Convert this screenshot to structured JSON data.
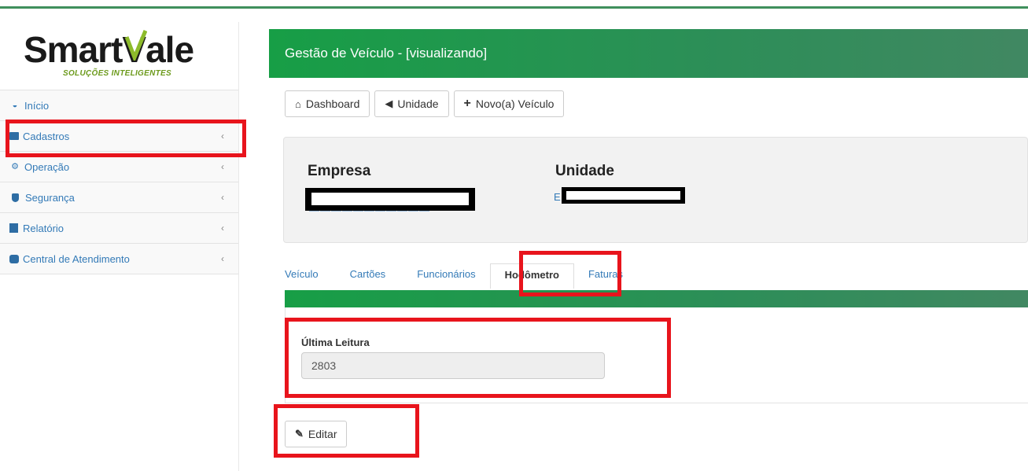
{
  "brand": {
    "name_prefix": "Smart",
    "name_v": "V",
    "name_suffix": "ale",
    "tagline": "SOLUÇÕES INTELIGENTES",
    "accent": "#6c9a1c"
  },
  "sidebar": {
    "items": [
      {
        "label": "Início",
        "icon": "dashboard-icon",
        "has_chevron": false
      },
      {
        "label": "Cadastros",
        "icon": "list-box-icon",
        "has_chevron": true
      },
      {
        "label": "Operação",
        "icon": "cogs-icon",
        "has_chevron": true
      },
      {
        "label": "Segurança",
        "icon": "shield-icon",
        "has_chevron": true
      },
      {
        "label": "Relatório",
        "icon": "report-icon",
        "has_chevron": true
      },
      {
        "label": "Central de Atendimento",
        "icon": "phone-icon",
        "has_chevron": true
      }
    ],
    "chevron": "‹"
  },
  "header": {
    "title": "Gestão de Veículo - [visualizando]",
    "color": "#179e46"
  },
  "toolbar": {
    "dashboard_label": "Dashboard",
    "unidade_label": "Unidade",
    "novo_label": "Novo(a) Veículo"
  },
  "panel": {
    "empresa_label": "Empresa",
    "unidade_label": "Unidade",
    "unidade_value_prefix": "E"
  },
  "tabs": [
    {
      "label": "Veículo",
      "active": false
    },
    {
      "label": "Cartões",
      "active": false
    },
    {
      "label": "Funcionários",
      "active": false
    },
    {
      "label": "Hodômetro",
      "active": true
    },
    {
      "label": "Faturas",
      "active": false
    }
  ],
  "form": {
    "ultima_leitura_label": "Última Leitura",
    "ultima_leitura_value": "2803"
  },
  "actions": {
    "edit_label": "Editar"
  },
  "colors": {
    "highlight": "#e8141c",
    "link": "#337ab7"
  }
}
